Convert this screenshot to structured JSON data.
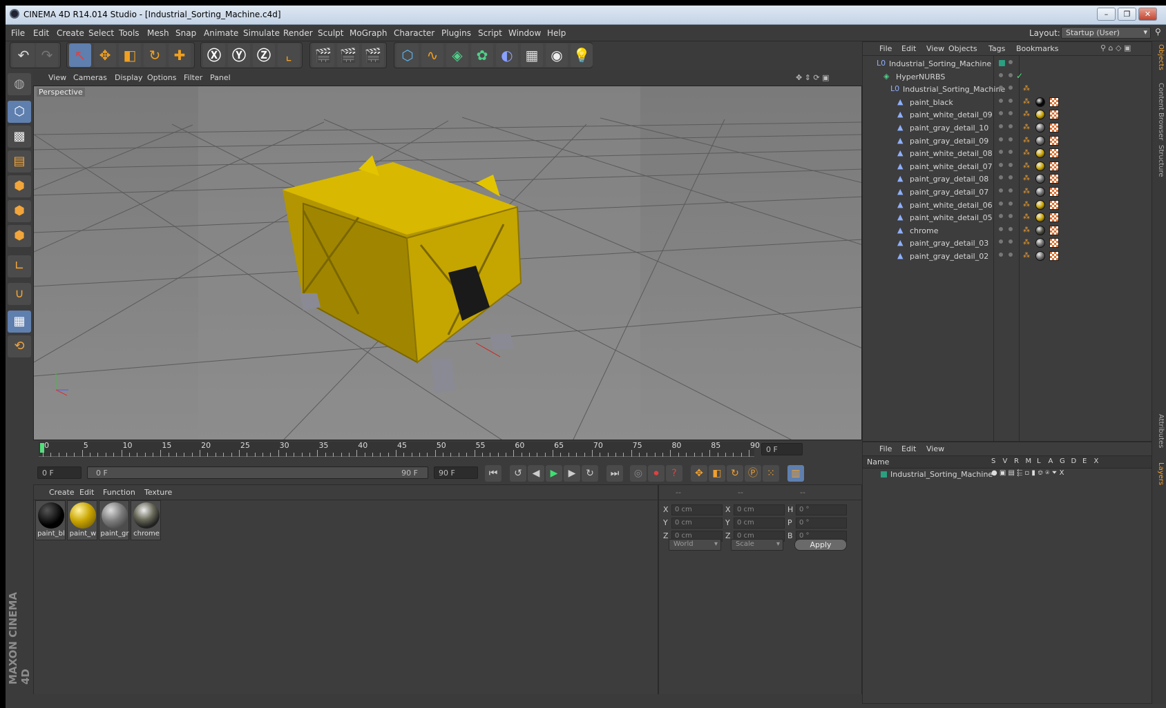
{
  "app_title": "CINEMA 4D R14.014 Studio - [Industrial_Sorting_Machine.c4d]",
  "menu": [
    "File",
    "Edit",
    "Create",
    "Select",
    "Tools",
    "Mesh",
    "Snap",
    "Animate",
    "Simulate",
    "Render",
    "Sculpt",
    "MoGraph",
    "Character",
    "Plugins",
    "Script",
    "Window",
    "Help"
  ],
  "layout": {
    "label": "Layout:",
    "value": "Startup (User)"
  },
  "viewport": {
    "menu": [
      "View",
      "Cameras",
      "Display",
      "Options",
      "Filter",
      "Panel"
    ],
    "label": "Perspective"
  },
  "timeline": {
    "ticks": [
      "0",
      "5",
      "10",
      "15",
      "20",
      "25",
      "30",
      "35",
      "40",
      "45",
      "50",
      "55",
      "60",
      "65",
      "70",
      "75",
      "80",
      "85",
      "90"
    ],
    "frame_field": "0 F"
  },
  "transport": {
    "start": "0 F",
    "slider_start": "0 F",
    "slider_end": "90 F",
    "end": "90 F"
  },
  "materials": {
    "menu": [
      "Create",
      "Edit",
      "Function",
      "Texture"
    ],
    "items": [
      {
        "label": "paint_bl",
        "color": "#050505"
      },
      {
        "label": "paint_w",
        "color": "#c9a400"
      },
      {
        "label": "paint_gr",
        "color": "#7b7b7b"
      },
      {
        "label": "chrome",
        "color": "#6a6a5a"
      }
    ]
  },
  "coords": {
    "headers": [
      "--",
      "--",
      "--"
    ],
    "rows": [
      {
        "a": "X",
        "av": "0 cm",
        "b": "X",
        "bv": "0 cm",
        "c": "H",
        "cv": "0 °"
      },
      {
        "a": "Y",
        "av": "0 cm",
        "b": "Y",
        "bv": "0 cm",
        "c": "P",
        "cv": "0 °"
      },
      {
        "a": "Z",
        "av": "0 cm",
        "b": "Z",
        "bv": "0 cm",
        "c": "B",
        "cv": "0 °"
      }
    ],
    "world": "World",
    "scale": "Scale",
    "apply": "Apply"
  },
  "objects": {
    "menu": [
      "File",
      "Edit",
      "View",
      "Objects",
      "Tags",
      "Bookmarks"
    ],
    "tree": [
      {
        "name": "Industrial_Sorting_Machine",
        "indent": 0,
        "tag": "none"
      },
      {
        "name": "HyperNURBS",
        "indent": 1,
        "tag": "check"
      },
      {
        "name": "Industrial_Sorting_Machine",
        "indent": 2,
        "tag": "phong"
      },
      {
        "name": "paint_black",
        "indent": 3,
        "mat": "#050505"
      },
      {
        "name": "paint_white_detail_09",
        "indent": 3,
        "mat": "#c9a400"
      },
      {
        "name": "paint_gray_detail_10",
        "indent": 3,
        "mat": "#6d6d6d"
      },
      {
        "name": "paint_gray_detail_09",
        "indent": 3,
        "mat": "#6d6d6d"
      },
      {
        "name": "paint_white_detail_08",
        "indent": 3,
        "mat": "#c9a400"
      },
      {
        "name": "paint_white_detail_07",
        "indent": 3,
        "mat": "#c9a400"
      },
      {
        "name": "paint_gray_detail_08",
        "indent": 3,
        "mat": "#6d6d6d"
      },
      {
        "name": "paint_gray_detail_07",
        "indent": 3,
        "mat": "#6d6d6d"
      },
      {
        "name": "paint_white_detail_06",
        "indent": 3,
        "mat": "#c9a400"
      },
      {
        "name": "paint_white_detail_05",
        "indent": 3,
        "mat": "#c9a400"
      },
      {
        "name": "chrome",
        "indent": 3,
        "mat": "#4a4a40"
      },
      {
        "name": "paint_gray_detail_03",
        "indent": 3,
        "mat": "#6d6d6d"
      },
      {
        "name": "paint_gray_detail_02",
        "indent": 3,
        "mat": "#6d6d6d"
      }
    ]
  },
  "layers": {
    "menu": [
      "File",
      "Edit",
      "View"
    ],
    "columns": [
      "Name",
      "S",
      "V",
      "R",
      "M",
      "L",
      "A",
      "G",
      "D",
      "E",
      "X"
    ],
    "row": "Industrial_Sorting_Machine"
  },
  "side_tabs": [
    "Objects",
    "Content Browser",
    "Structure",
    "Attributes",
    "Layers"
  ],
  "brand": "MAXON CINEMA 4D"
}
